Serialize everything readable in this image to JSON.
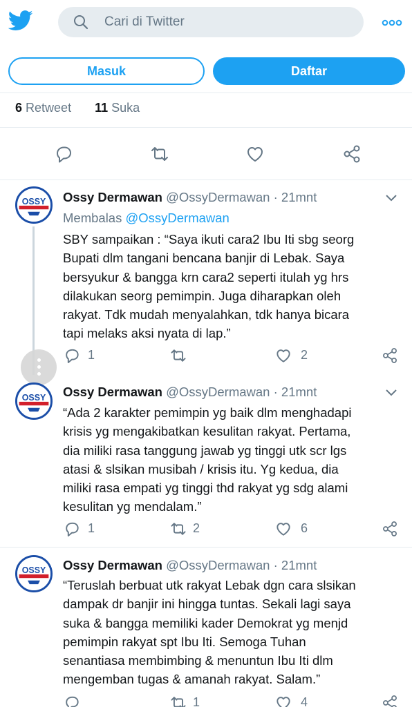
{
  "header": {
    "search_placeholder": "Cari di Twitter",
    "logo_icon": "twitter-bird-icon",
    "more_icon": "more-options-icon",
    "brand_color": "#1da1f2"
  },
  "auth": {
    "login_label": "Masuk",
    "signup_label": "Daftar"
  },
  "stats": {
    "retweet_count": "6",
    "retweet_label": "Retweet",
    "like_count": "11",
    "like_label": "Suka"
  },
  "tweets": [
    {
      "name": "Ossy Dermawan",
      "handle": "@OssyDermawan",
      "time": "· 21mnt",
      "reply_prefix": "Membalas",
      "reply_mention": "@OssyDermawan",
      "avatar_label": "OSSY",
      "text": "SBY sampaikan : “Saya ikuti cara2 Ibu Iti sbg seorg\nBupati dlm tangani bencana banjir di Lebak. Saya\nbersyukur & bangga krn cara2 seperti itulah yg hrs\ndilakukan seorg pemimpin. Juga diharapkan oleh\nrakyat. Tdk mudah menyalahkan, tdk hanya bicara\ntapi melaks aksi nyata di lap.”",
      "replies": "1",
      "retweets": "",
      "likes": "2"
    },
    {
      "name": "Ossy Dermawan",
      "handle": "@OssyDermawan",
      "time": "· 21mnt",
      "avatar_label": "OSSY",
      "text": "“Ada 2 karakter pemimpin yg baik dlm menghadapi\nkrisis yg mengakibatkan kesulitan rakyat. Pertama,\ndia miliki rasa tanggung jawab yg tinggi utk scr lgs\natasi & slsikan musibah / krisis itu. Yg kedua, dia\nmiliki rasa empati yg tinggi thd rakyat yg sdg alami\nkesulitan yg mendalam.”",
      "replies": "1",
      "retweets": "2",
      "likes": "6"
    },
    {
      "name": "Ossy Dermawan",
      "handle": "@OssyDermawan",
      "time": "· 21mnt",
      "avatar_label": "OSSY",
      "text": "“Teruslah berbuat utk rakyat Lebak dgn cara slsikan\ndampak dr banjir ini hingga tuntas. Sekali lagi saya\nsuka & bangga memiliki kader Demokrat yg menjd\npemimpin rakyat spt Ibu Iti. Semoga Tuhan\nsenantiasa membimbing & menuntun Ibu Iti dlm\nmengemban tugas & amanah rakyat. Salam.”",
      "replies": "",
      "retweets": "1",
      "likes": "4"
    }
  ]
}
